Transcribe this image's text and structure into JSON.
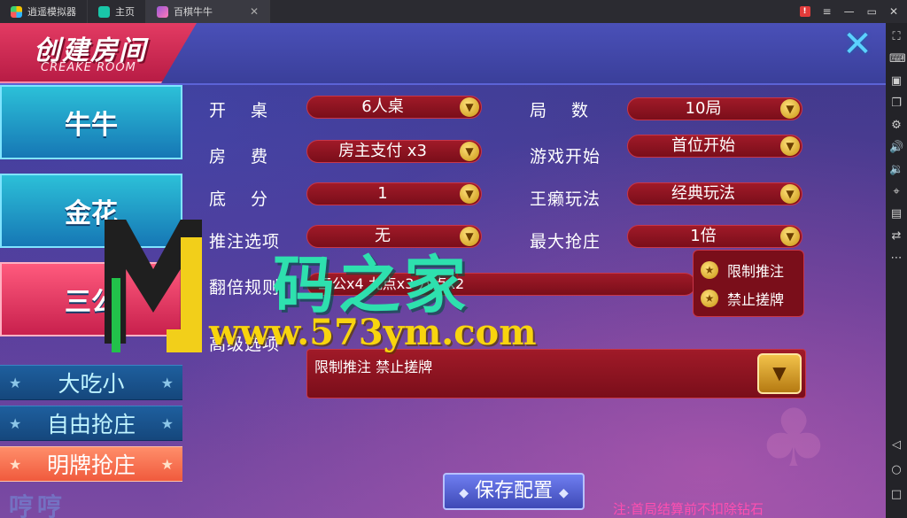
{
  "titlebar": {
    "tabs": [
      {
        "label": "逍遥模拟器"
      },
      {
        "label": "主页"
      },
      {
        "label": "百棋牛牛"
      }
    ],
    "controls": [
      "!",
      "≡",
      "▭",
      "✕"
    ]
  },
  "header": {
    "title": "创建房间",
    "subtitle": "CREAKE ROOM"
  },
  "menu": {
    "items": [
      {
        "label": "牛牛"
      },
      {
        "label": "金花"
      },
      {
        "label": "三公"
      },
      {
        "label": "大吃小"
      },
      {
        "label": "自由抢庄"
      },
      {
        "label": "明牌抢庄"
      }
    ],
    "deco": "哼哼"
  },
  "options": {
    "table": {
      "label": "开桌",
      "value": "6人桌"
    },
    "rounds": {
      "label": "局数",
      "value": "10局"
    },
    "fee": {
      "label": "房费",
      "value": "房主支付 x3"
    },
    "start": {
      "label": "游戏开始",
      "value": "首位开始"
    },
    "base": {
      "label": "底分",
      "value": "1"
    },
    "wild": {
      "label": "王癞玩法",
      "value": "经典玩法"
    },
    "push": {
      "label": "推注选项",
      "value": "无"
    },
    "banker": {
      "label": "最大抢庄",
      "value": "1倍"
    },
    "double": {
      "label": "翻倍规则",
      "value": "三公x4 九点x3 八点x2"
    },
    "advanced": {
      "label": "高级选项",
      "value": "限制推注 禁止搓牌"
    }
  },
  "popup": {
    "items": [
      {
        "label": "限制推注"
      },
      {
        "label": "禁止搓牌"
      }
    ]
  },
  "save_label": "保存配置",
  "note": "注:首局结算前不扣除钻石",
  "watermark": {
    "title": "码之家",
    "url": "www.573ym.com"
  }
}
